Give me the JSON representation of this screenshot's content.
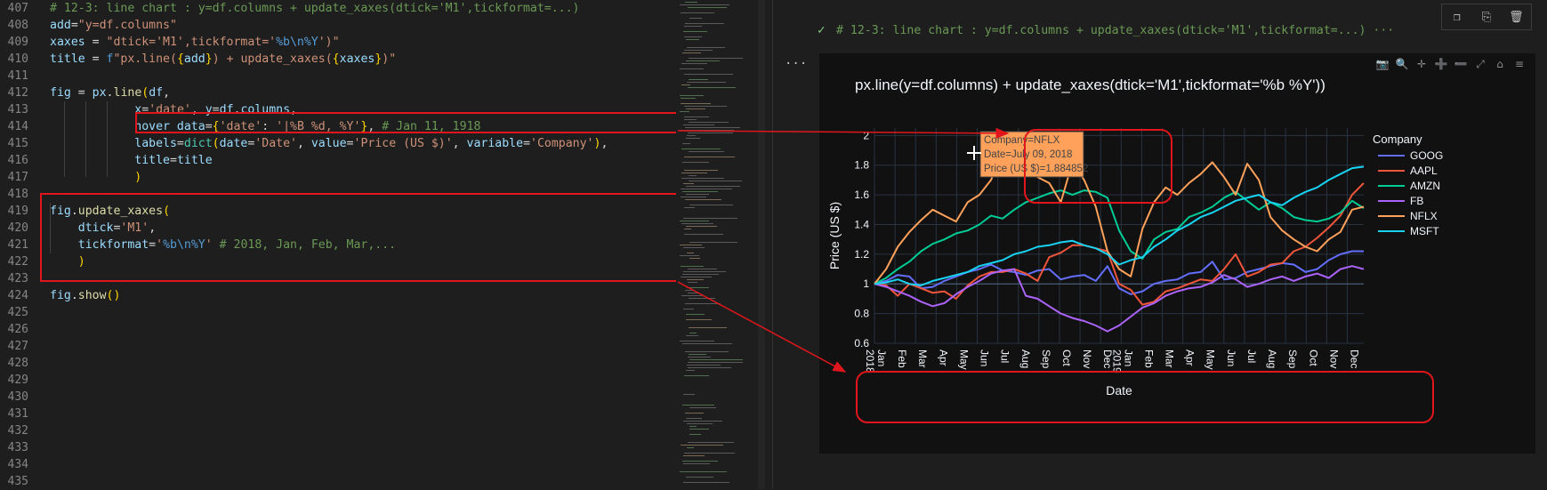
{
  "editor": {
    "lines": [
      {
        "num": "407",
        "html": [
          [
            "cm",
            "# 12-3: line chart : y=df.columns + update_xaxes(dtick='M1',tickformat=...)"
          ]
        ]
      },
      {
        "num": "408",
        "html": [
          [
            "va",
            "add"
          ],
          [
            "",
            "="
          ],
          [
            "st",
            "\"y=df.columns\""
          ]
        ]
      },
      {
        "num": "409",
        "html": [
          [
            "va",
            "xaxes"
          ],
          [
            "",
            " = "
          ],
          [
            "st",
            "\"dtick='M1',tickformat='"
          ],
          [
            "kw",
            "%b\\n%Y"
          ],
          [
            "st",
            "')\""
          ]
        ]
      },
      {
        "num": "410",
        "html": [
          [
            "va",
            "title"
          ],
          [
            "",
            " = "
          ],
          [
            "kw",
            "f"
          ],
          [
            "st",
            "\"px.line("
          ],
          [
            "br",
            "{"
          ],
          [
            "va",
            "add"
          ],
          [
            "br",
            "}"
          ],
          [
            "st",
            ") + update_xaxes("
          ],
          [
            "br",
            "{"
          ],
          [
            "va",
            "xaxes"
          ],
          [
            "br",
            "}"
          ],
          [
            "st",
            ")\""
          ]
        ]
      },
      {
        "num": "411",
        "html": []
      },
      {
        "num": "412",
        "html": [
          [
            "va",
            "fig"
          ],
          [
            "",
            " = "
          ],
          [
            "va",
            "px"
          ],
          [
            "",
            "."
          ],
          [
            "fn",
            "line"
          ],
          [
            "br",
            "("
          ],
          [
            "va",
            "df"
          ],
          [
            "",
            ","
          ]
        ]
      },
      {
        "num": "413",
        "html": [
          [
            "",
            "            "
          ],
          [
            "va",
            "x"
          ],
          [
            "",
            "="
          ],
          [
            "st",
            "'date'"
          ],
          [
            "",
            ", "
          ],
          [
            "va",
            "y"
          ],
          [
            "",
            "="
          ],
          [
            "va",
            "df"
          ],
          [
            "",
            "."
          ],
          [
            "va",
            "columns"
          ],
          [
            "",
            ","
          ]
        ]
      },
      {
        "num": "414",
        "html": [
          [
            "",
            "            "
          ],
          [
            "va",
            "hover_data"
          ],
          [
            "",
            "="
          ],
          [
            "br",
            "{"
          ],
          [
            "st",
            "'date'"
          ],
          [
            "",
            ": "
          ],
          [
            "st",
            "'|%B %d, %Y'"
          ],
          [
            "br",
            "}"
          ],
          [
            "",
            ", "
          ],
          [
            "cm",
            "# Jan 11, 1918"
          ]
        ]
      },
      {
        "num": "415",
        "html": [
          [
            "",
            "            "
          ],
          [
            "va",
            "labels"
          ],
          [
            "",
            "="
          ],
          [
            "ob",
            "dict"
          ],
          [
            "br",
            "("
          ],
          [
            "va",
            "date"
          ],
          [
            "",
            "="
          ],
          [
            "st",
            "'Date'"
          ],
          [
            "",
            ", "
          ],
          [
            "va",
            "value"
          ],
          [
            "",
            "="
          ],
          [
            "st",
            "'Price (US $)'"
          ],
          [
            "",
            ", "
          ],
          [
            "va",
            "variable"
          ],
          [
            "",
            "="
          ],
          [
            "st",
            "'Company'"
          ],
          [
            "br",
            ")"
          ],
          [
            "",
            ","
          ]
        ]
      },
      {
        "num": "416",
        "html": [
          [
            "",
            "            "
          ],
          [
            "va",
            "title"
          ],
          [
            "",
            "="
          ],
          [
            "va",
            "title"
          ]
        ]
      },
      {
        "num": "417",
        "html": [
          [
            "",
            "            "
          ],
          [
            "br",
            ")"
          ]
        ]
      },
      {
        "num": "418",
        "html": []
      },
      {
        "num": "419",
        "html": [
          [
            "va",
            "fig"
          ],
          [
            "",
            "."
          ],
          [
            "fn",
            "update_xaxes"
          ],
          [
            "br",
            "("
          ]
        ]
      },
      {
        "num": "420",
        "html": [
          [
            "",
            "    "
          ],
          [
            "va",
            "dtick"
          ],
          [
            "",
            "="
          ],
          [
            "st",
            "'M1'"
          ],
          [
            "",
            ","
          ]
        ]
      },
      {
        "num": "421",
        "html": [
          [
            "",
            "    "
          ],
          [
            "va",
            "tickformat"
          ],
          [
            "",
            "="
          ],
          [
            "st",
            "'"
          ],
          [
            "kw",
            "%b\\n%Y"
          ],
          [
            "st",
            "'"
          ],
          [
            "",
            " "
          ],
          [
            "cm",
            "# 2018, Jan, Feb, Mar,..."
          ]
        ]
      },
      {
        "num": "422",
        "html": [
          [
            "",
            "    "
          ],
          [
            "br",
            ")"
          ]
        ]
      },
      {
        "num": "423",
        "html": []
      },
      {
        "num": "424",
        "html": [
          [
            "va",
            "fig"
          ],
          [
            "",
            "."
          ],
          [
            "fn",
            "show"
          ],
          [
            "br",
            "()"
          ]
        ]
      },
      {
        "num": "425",
        "html": []
      },
      {
        "num": "426",
        "html": []
      },
      {
        "num": "427",
        "html": []
      },
      {
        "num": "428",
        "html": []
      },
      {
        "num": "429",
        "html": []
      },
      {
        "num": "430",
        "html": []
      },
      {
        "num": "431",
        "html": []
      },
      {
        "num": "432",
        "html": []
      },
      {
        "num": "433",
        "html": []
      },
      {
        "num": "434",
        "html": []
      },
      {
        "num": "435",
        "html": []
      }
    ]
  },
  "output": {
    "cell_header": "# 12-3: line chart : y=df.columns + update_xaxes(dtick='M1',tickformat=...) ···",
    "check_glyph": "✓",
    "ellipsis": "...",
    "toolbar_icons": [
      "copy-icon",
      "paste-icon",
      "trash-icon"
    ]
  },
  "plot": {
    "modebar": [
      "📷",
      "🔍",
      "✛",
      "➕",
      "➖",
      "⤢",
      "⌂",
      "≡"
    ]
  },
  "chart_data": {
    "type": "line",
    "title": "px.line(y=df.columns) + update_xaxes(dtick='M1',tickformat='%b %Y'))",
    "xlabel": "Date",
    "ylabel": "Price (US $)",
    "ylim": [
      0.6,
      2.05
    ],
    "yticks": [
      "0.6",
      "0.8",
      "1",
      "1.2",
      "1.4",
      "1.6",
      "1.8",
      "2"
    ],
    "yticks_values": [
      0.6,
      0.8,
      1.0,
      1.2,
      1.4,
      1.6,
      1.8,
      2.0
    ],
    "xticks": [
      "Jan\n2018",
      "Feb",
      "Mar",
      "Apr",
      "May",
      "Jun",
      "Jul",
      "Aug",
      "Sep",
      "Oct",
      "Nov",
      "Dec",
      "Jan\n2019",
      "Feb",
      "Mar",
      "Apr",
      "May",
      "Jun",
      "Jul",
      "Aug",
      "Sep",
      "Oct",
      "Nov",
      "Dec"
    ],
    "legend_title": "Company",
    "legend_position": "right",
    "grid": true,
    "series": [
      {
        "name": "GOOG",
        "color": "#636efa",
        "values": [
          1.0,
          1.02,
          1.06,
          1.05,
          0.97,
          0.98,
          1.02,
          1.05,
          1.08,
          1.1,
          1.13,
          1.09,
          1.08,
          1.06,
          1.09,
          1.1,
          1.03,
          1.05,
          1.06,
          1.02,
          1.12,
          0.97,
          0.93,
          0.95,
          1.0,
          1.02,
          1.03,
          1.07,
          1.08,
          1.15,
          1.03,
          1.04,
          1.08,
          1.1,
          1.12,
          1.14,
          1.13,
          1.08,
          1.1,
          1.16,
          1.2,
          1.22,
          1.22
        ]
      },
      {
        "name": "AAPL",
        "color": "#ef553b",
        "values": [
          1.0,
          0.99,
          0.92,
          1.0,
          0.97,
          0.94,
          0.95,
          0.9,
          0.99,
          1.05,
          1.08,
          1.08,
          1.1,
          1.07,
          1.02,
          1.18,
          1.21,
          1.26,
          1.26,
          1.24,
          1.22,
          1.0,
          0.96,
          0.86,
          0.88,
          0.95,
          0.97,
          1.0,
          1.03,
          1.02,
          1.1,
          1.2,
          1.05,
          1.08,
          1.13,
          1.14,
          1.22,
          1.25,
          1.31,
          1.38,
          1.46,
          1.6,
          1.68
        ]
      },
      {
        "name": "AMZN",
        "color": "#00cc96",
        "values": [
          1.0,
          1.04,
          1.1,
          1.15,
          1.22,
          1.27,
          1.3,
          1.34,
          1.36,
          1.4,
          1.46,
          1.44,
          1.5,
          1.55,
          1.58,
          1.61,
          1.63,
          1.6,
          1.63,
          1.62,
          1.58,
          1.36,
          1.22,
          1.17,
          1.3,
          1.35,
          1.37,
          1.45,
          1.48,
          1.52,
          1.58,
          1.62,
          1.56,
          1.5,
          1.55,
          1.51,
          1.45,
          1.43,
          1.42,
          1.44,
          1.48,
          1.56,
          1.51
        ]
      },
      {
        "name": "FB",
        "color": "#ab63fa",
        "values": [
          1.0,
          0.98,
          0.95,
          0.92,
          0.88,
          0.85,
          0.87,
          0.93,
          0.98,
          1.02,
          1.07,
          1.09,
          1.1,
          0.92,
          0.9,
          0.85,
          0.8,
          0.77,
          0.75,
          0.72,
          0.68,
          0.72,
          0.78,
          0.84,
          0.87,
          0.92,
          0.95,
          0.97,
          0.98,
          1.01,
          1.06,
          1.03,
          0.98,
          1.0,
          1.03,
          1.05,
          1.02,
          1.05,
          1.07,
          1.04,
          1.1,
          1.12,
          1.1
        ]
      },
      {
        "name": "NFLX",
        "color": "#ffa15a",
        "values": [
          1.0,
          1.1,
          1.25,
          1.35,
          1.43,
          1.5,
          1.46,
          1.42,
          1.55,
          1.6,
          1.7,
          1.88,
          1.95,
          1.8,
          1.72,
          1.68,
          1.55,
          1.82,
          1.7,
          1.52,
          1.22,
          1.1,
          1.05,
          1.37,
          1.55,
          1.65,
          1.6,
          1.68,
          1.74,
          1.82,
          1.72,
          1.6,
          1.81,
          1.7,
          1.45,
          1.36,
          1.3,
          1.25,
          1.22,
          1.3,
          1.35,
          1.5,
          1.52
        ]
      },
      {
        "name": "MSFT",
        "color": "#19d3f3",
        "values": [
          1.0,
          1.01,
          1.03,
          1.0,
          0.99,
          1.02,
          1.04,
          1.06,
          1.08,
          1.12,
          1.14,
          1.16,
          1.2,
          1.22,
          1.25,
          1.26,
          1.28,
          1.29,
          1.26,
          1.24,
          1.2,
          1.13,
          1.16,
          1.18,
          1.25,
          1.3,
          1.36,
          1.4,
          1.45,
          1.48,
          1.52,
          1.56,
          1.58,
          1.6,
          1.55,
          1.53,
          1.58,
          1.62,
          1.65,
          1.7,
          1.74,
          1.78,
          1.79
        ]
      }
    ],
    "hover": {
      "lines": [
        "Company=NFLX",
        "Date=July 09, 2018",
        "Price (US $)=1.884852"
      ],
      "color": "#ffa15a"
    }
  }
}
